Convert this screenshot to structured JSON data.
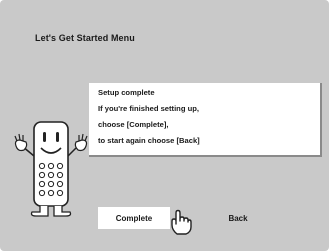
{
  "menu": {
    "title": "Let's Get Started Menu"
  },
  "message": {
    "lines": [
      "Setup complete",
      "If you're finished setting up,",
      "choose [Complete],",
      "to start again choose [Back]"
    ]
  },
  "buttons": {
    "complete_label": "Complete",
    "back_label": "Back",
    "selected": "Complete"
  },
  "icons": {
    "mascot": "remote-control-mascot-icon",
    "cursor": "pointing-hand-cursor-icon"
  },
  "colors": {
    "background": "#c9c9c9",
    "panel": "#ffffff",
    "text": "#1a1a1a"
  }
}
